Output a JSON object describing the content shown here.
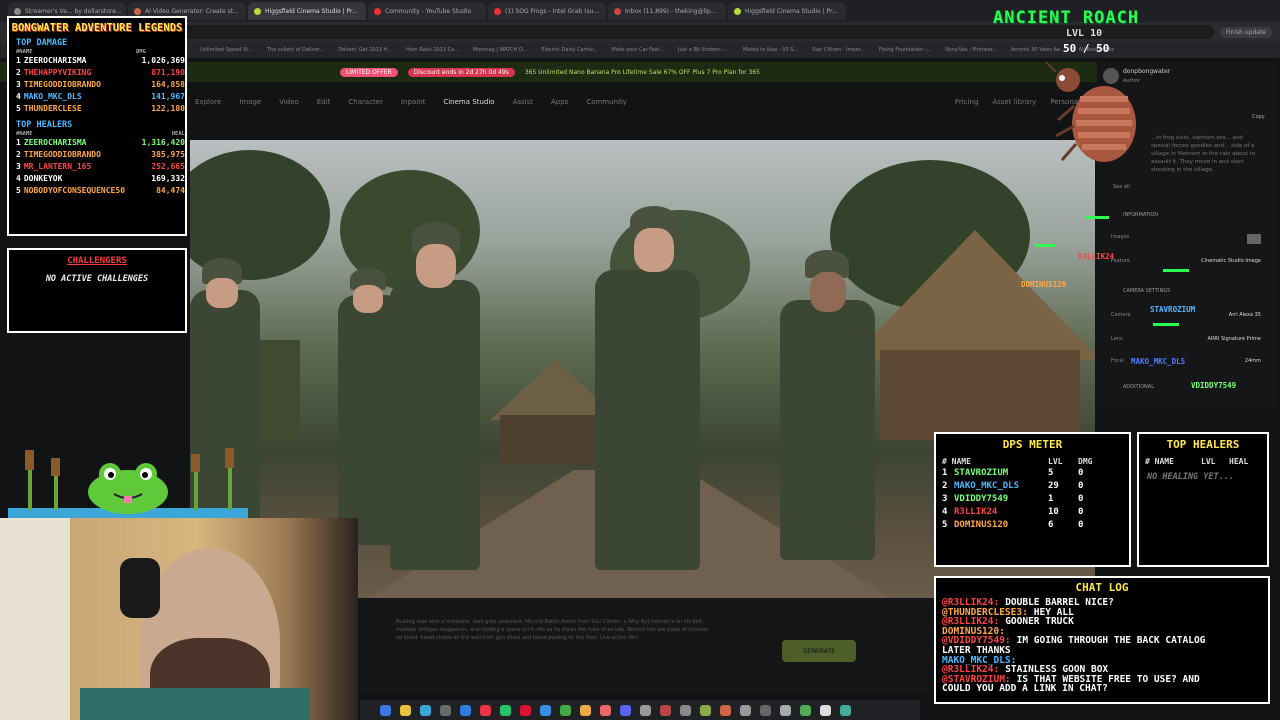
{
  "browser": {
    "tabs": [
      "Streamer's Va... by dollarstore...",
      "AI Video Generator: Create st...",
      "Higgsfield Cinema Studio | Pr...",
      "Community - YouTube Studio",
      "(1) SOG Frogs - Intel Grab (su...",
      "Inbox (11,899) - theking@lip...",
      "Higgsfield Cinema Studio | Pr..."
    ],
    "bookmarks": [
      "Unlimited Speed St...",
      "The collect of Deliver...",
      "Deltarr: Get 2013 H...",
      "Ham Raini 2013 Co...",
      "Moonrag | WATCH O...",
      "Electric Daisy Carniv...",
      "Make your Car Fast...",
      "Just a Bit Embers -...",
      "Mated to Ikap - 03 S...",
      "Star Citizen - Impor...",
      "Fixing Foundation -...",
      "Nyra/Vex - Firmwar...",
      "Acronis 30 Yates Ae...",
      "All Bookmarks"
    ],
    "finish_update": "Finish update"
  },
  "site": {
    "promo_pill": "LIMITED OFFER",
    "promo_pill2": "Discount ends in 2d 27h 0d 49s",
    "promo_text": "365 Unlimited Nano Banana Pro  Lifetime Sale  67% OFF  Plus 7 Pro Plan for 365",
    "nav": [
      "Explore",
      "Image",
      "Video",
      "Edit",
      "Character",
      "Inpaint",
      "Cinema Studio",
      "Assist",
      "Apps",
      "Community"
    ],
    "nav_right": [
      "Pricing",
      "Asset library",
      "Personal"
    ],
    "prompt_text": "Bulldog man with a moriache, dark grey undersuit, Microid Battle Armor from Star Citizen, a Why Not helmet is on his belt, multiple shotgun magazines, and holding a space sci-fi rifle as he stalks the halls of an idle. Behind him are pools of crimson he killed, blood visible on the wall from gun shots and blood pooling on the floor. Live action film.",
    "generate_label": "GENERATE",
    "author": "donpbongwater",
    "author_sub": "Author",
    "copy": "Copy",
    "desc": "...in frog suits, vietnam era... and special forces goodies and... side of a village in Vietnam in the rain about to assault it. They move in and start shooting in the village.",
    "see_all": "See all",
    "info_label": "INFORMATION",
    "info_rows": [
      {
        "k": "Images",
        "v": ""
      },
      {
        "k": "Feature",
        "v": "Cinematic Studio Image"
      }
    ],
    "camera_label": "CAMERA SETTINGS",
    "camera_rows": [
      {
        "k": "Camera",
        "v": "Arri Alexa 35"
      },
      {
        "k": "Lens",
        "v": "ARRI Signature Prime"
      },
      {
        "k": "Focal",
        "v": "24mm"
      }
    ],
    "additional_label": "ADDITIONAL"
  },
  "overlay": {
    "legends_title": "BONGWATER ADVENTURE LEGENDS",
    "top_damage_label": "TOP DAMAGE",
    "name_col": "#NAME",
    "dmg_col": "DMG",
    "heal_col": "HEAL",
    "top_damage": [
      {
        "rank": "1",
        "name": "ZEEROCHARISMA",
        "value": "1,026,369",
        "color": "#ffffff"
      },
      {
        "rank": "2",
        "name": "THEHAPPYVIKING",
        "value": "871,190",
        "color": "#ff4444"
      },
      {
        "rank": "3",
        "name": "TIMEGODDIOBRANDO",
        "value": "164,858",
        "color": "#ffa94a"
      },
      {
        "rank": "4",
        "name": "MAKO_MKC_DLS",
        "value": "141,967",
        "color": "#4fb9ff"
      },
      {
        "rank": "5",
        "name": "THUNDERCLESE",
        "value": "122,180",
        "color": "#ffa94a"
      }
    ],
    "top_healers_label": "TOP HEALERS",
    "top_healers": [
      {
        "rank": "1",
        "name": "ZEEROCHARISMA",
        "value": "1,316,420",
        "color": "#7dff7a"
      },
      {
        "rank": "2",
        "name": "TIMEGODDIOBRANDO",
        "value": "385,975",
        "color": "#ffa94a"
      },
      {
        "rank": "3",
        "name": "MR_LANTERN_165",
        "value": "252,665",
        "color": "#ff4444"
      },
      {
        "rank": "4",
        "name": "DONKEYOK",
        "value": "169,332",
        "color": "#ffffff"
      },
      {
        "rank": "5",
        "name": "NOBODYOFCONSEQUENCE50",
        "value": "84,474",
        "color": "#ffa94a"
      }
    ],
    "challenges_title": "CHALLENGERS",
    "challenges_msg": "NO ACTIVE CHALLENGES",
    "boss_name": "ANCIENT ROACH",
    "boss_lvl": "LVL 10",
    "boss_hp": "50 / 50",
    "sprites": [
      {
        "name": "R3LLIK24",
        "color": "#ff4444"
      },
      {
        "name": "DOMINUS120",
        "color": "#ffa94a"
      },
      {
        "name": "STAVROZIUM",
        "color": "#4fb9ff"
      },
      {
        "name": "MAKO_MKC_DLS",
        "color": "#4f7bff"
      },
      {
        "name": "VDIDDY7549",
        "color": "#7dff7a"
      }
    ],
    "dps_title": "DPS METER",
    "dps_cols": [
      "# NAME",
      "LVL",
      "DMG"
    ],
    "dps_rows": [
      {
        "rank": "1",
        "name": "STAVROZIUM",
        "lvl": "5",
        "dmg": "0",
        "color": "#7dff7a"
      },
      {
        "rank": "2",
        "name": "MAKO_MKC_DLS",
        "lvl": "29",
        "dmg": "0",
        "color": "#4fb9ff"
      },
      {
        "rank": "3",
        "name": "VDIDDY7549",
        "lvl": "1",
        "dmg": "0",
        "color": "#7dff7a"
      },
      {
        "rank": "4",
        "name": "R3LLIK24",
        "lvl": "10",
        "dmg": "0",
        "color": "#ff4444"
      },
      {
        "rank": "5",
        "name": "DOMINUS120",
        "lvl": "6",
        "dmg": "0",
        "color": "#ffa94a"
      }
    ],
    "heal_title": "TOP HEALERS",
    "heal_cols": [
      "# NAME",
      "LVL",
      "HEAL"
    ],
    "heal_empty": "NO HEALING YET...",
    "chat_title": "CHAT LOG",
    "chat": [
      {
        "user": "@R3LLIK24:",
        "msg": "DOUBLE BARREL NICE?",
        "ucolor": "#ff4444"
      },
      {
        "user": "@THUNDERCLESE3:",
        "msg": "HEY ALL",
        "ucolor": "#ffa94a"
      },
      {
        "user": "@R3LLIK24:",
        "msg": "GOONER TRUCK",
        "ucolor": "#ff4444"
      },
      {
        "user": "DOMINUS120:",
        "msg": "",
        "ucolor": "#ffa94a"
      },
      {
        "user": "@VDIDDY7549:",
        "msg": "IM GOING THROUGH THE BACK CATALOG",
        "ucolor": "#ff4444"
      },
      {
        "user": "LATER THANKS",
        "msg": "",
        "ucolor": "#ffffff"
      },
      {
        "user": "MAKO_MKC_DLS:",
        "msg": "",
        "ucolor": "#4fb9ff"
      },
      {
        "user": "@R3LLIK24:",
        "msg": "STAINLESS GOON BOX",
        "ucolor": "#ff4444"
      },
      {
        "user": "@STAVROZIUM:",
        "msg": "IS THAT WEBSITE FREE TO USE? AND",
        "ucolor": "#ff4444"
      },
      {
        "user": "COULD YOU ADD A LINK IN CHAT?",
        "msg": "",
        "ucolor": "#ffffff"
      }
    ]
  }
}
